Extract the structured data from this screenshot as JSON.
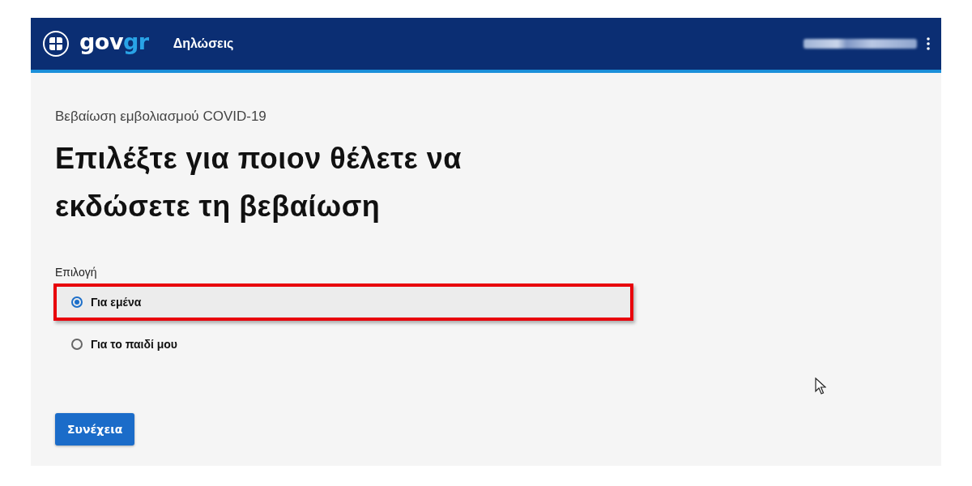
{
  "header": {
    "logo": {
      "text": "gov",
      "accent": "gr"
    },
    "nav_title": "Δηλώσεις"
  },
  "breadcrumb": "Βεβαίωση εμβολιασμού COVID-19",
  "title": "Επιλέξτε για ποιον θέλετε να εκδώσετε τη βεβαίωση",
  "field_label": "Επιλογή",
  "options": [
    {
      "label": "Για εμένα",
      "selected": true,
      "highlighted": true
    },
    {
      "label": "Για το παιδί μου",
      "selected": false,
      "highlighted": false
    }
  ],
  "continue_button": "Συνέχεια"
}
